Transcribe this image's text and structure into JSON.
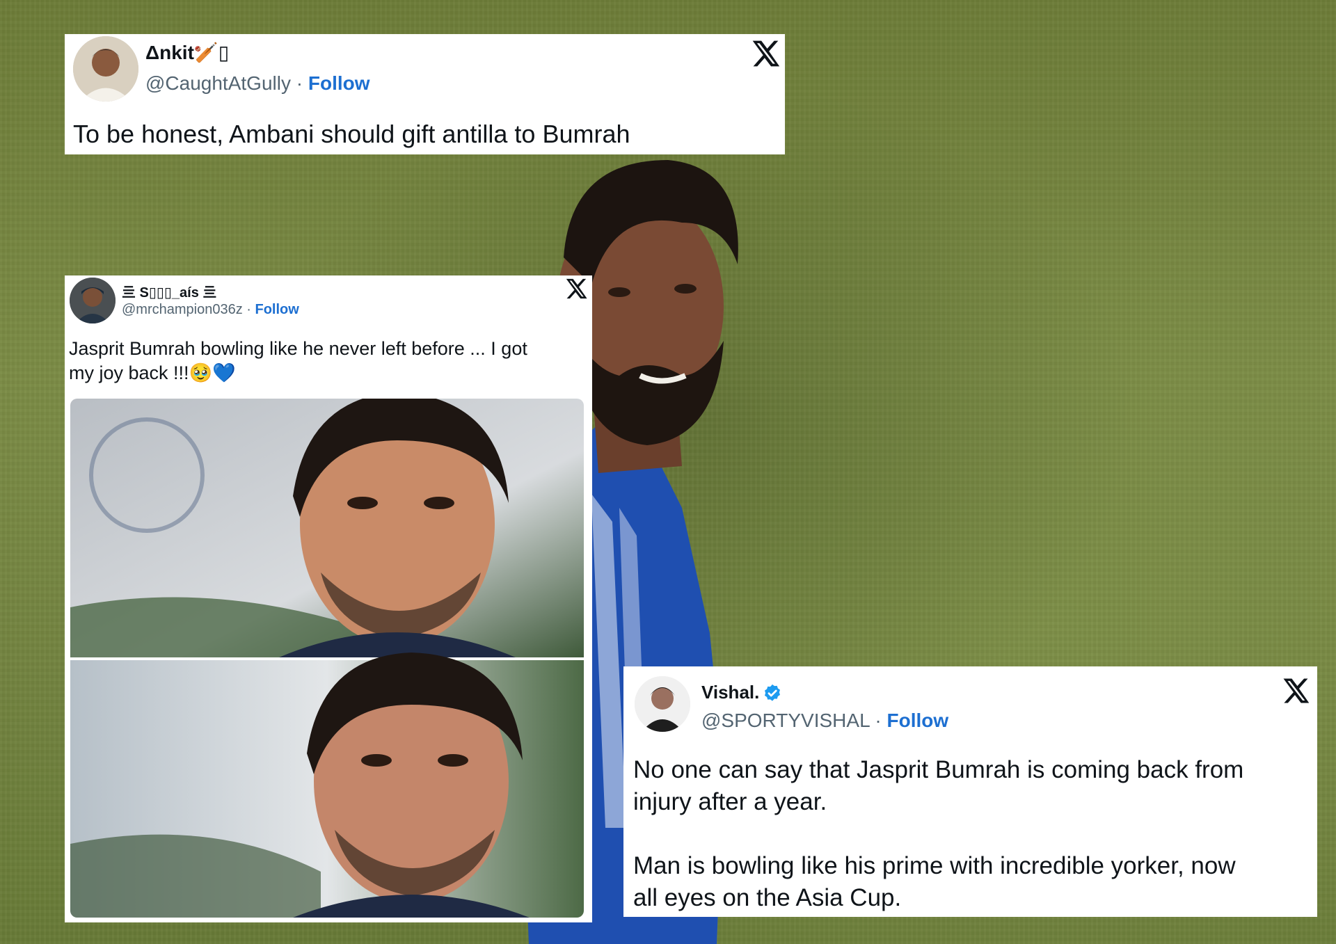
{
  "tweets": [
    {
      "display_name": "Δnkit🏏▯",
      "handle": "@CaughtAtGully",
      "separator": " · ",
      "follow_label": "Follow",
      "text": "To be honest, Ambani should gift antilla to Bumrah"
    },
    {
      "display_name": "亖 S▯▯▯_aís 亖",
      "handle": "@mrchampion036z",
      "separator": " · ",
      "follow_label": "Follow",
      "text": "Jasprit Bumrah bowling like he never left before ... I got\nmy joy back !!!🥹💙",
      "has_image": true
    },
    {
      "display_name": "Vishal.",
      "verified": true,
      "handle": "@SPORTYVISHAL",
      "separator": " · ",
      "follow_label": "Follow",
      "text": "No one can say that Jasprit Bumrah is coming back from\ninjury after a year.\n\nMan is bowling like his prime with incredible yorker, now\nall eyes on the Asia Cup."
    }
  ],
  "icons": {
    "platform": "x-logo-icon",
    "verified": "verified-badge-icon"
  },
  "colors": {
    "follow": "#1d6fd1",
    "verified": "#1d9bf0",
    "card_bg": "#ffffff",
    "grass": "#738440",
    "jersey": "#1f4fb0"
  }
}
